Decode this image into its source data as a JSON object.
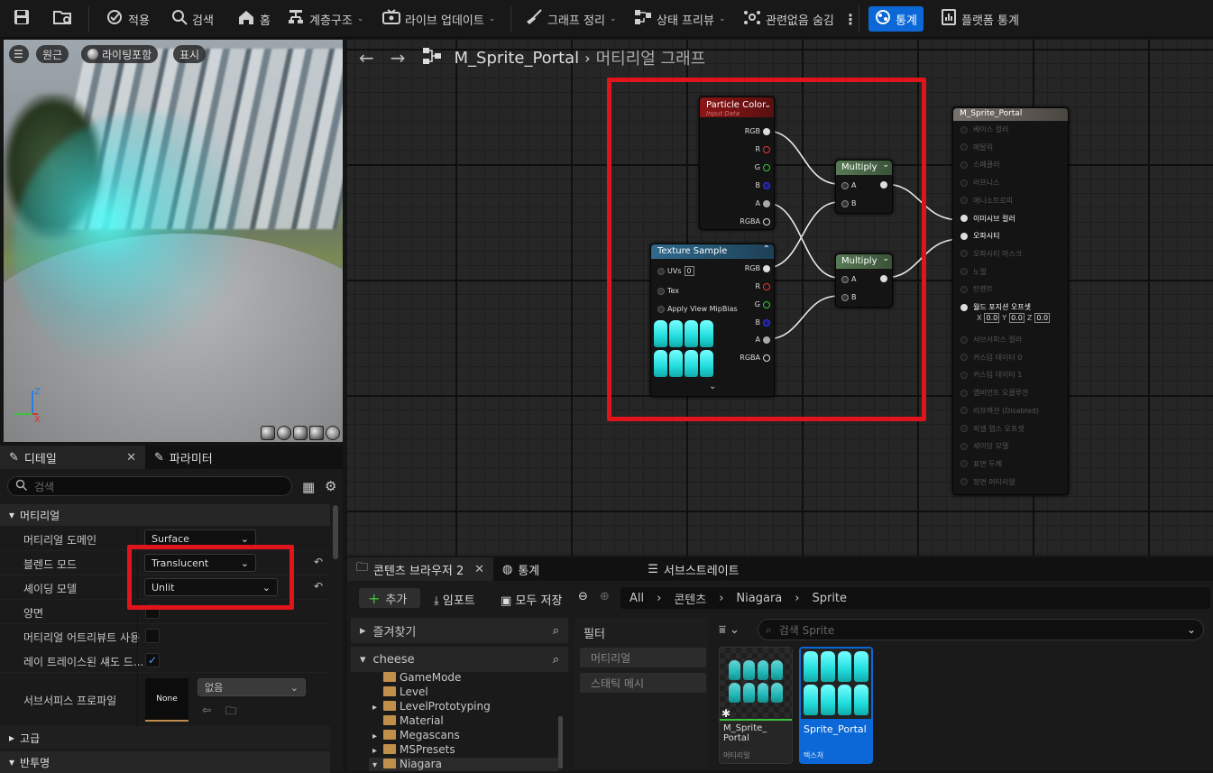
{
  "toolbar": {
    "apply": "적용",
    "search": "검색",
    "home": "홈",
    "hierarchy": "계층구조",
    "live_update": "라이브 업데이트",
    "clean_graph": "그래프 정리",
    "state_preview": "상태 프리뷰",
    "hide_unrelated": "관련없음 숨김",
    "stats": "통계",
    "platform_stats": "플랫폼 통계"
  },
  "viewport": {
    "btn_perspective": "원근",
    "btn_lit": "라이팅포함",
    "btn_show": "표시"
  },
  "details": {
    "tab_details": "디테일",
    "tab_params": "파라미터",
    "search_placeholder": "검색",
    "section_material": "머티리얼",
    "props": {
      "domain_label": "머티리얼 도메인",
      "domain_value": "Surface",
      "blend_label": "블렌드 모드",
      "blend_value": "Translucent",
      "shading_label": "셰이딩 모델",
      "shading_value": "Unlit",
      "twosided_label": "양면",
      "use_attr_label": "머티리얼 어트리뷰트 사용",
      "rt_shadow_label": "레이 트레이스된 섀도 드...",
      "subsurface_label": "서브서피스 프로파일",
      "subsurface_none": "None",
      "subsurface_value": "없음"
    },
    "rt_shadow_checked": true,
    "section_advanced": "고급",
    "section_translucency": "반투명"
  },
  "graph": {
    "asset_name": "M_Sprite_Portal",
    "graph_title": "머티리얼 그래프",
    "particle_color": {
      "title": "Particle Color",
      "subtitle": "Input Data",
      "pins": [
        "RGB",
        "R",
        "G",
        "B",
        "A",
        "RGBA"
      ]
    },
    "texture_sample": {
      "title": "Texture Sample",
      "inputs": [
        "UVs",
        "Tex",
        "Apply View MipBias"
      ],
      "uv_value": "0",
      "pins": [
        "RGB",
        "R",
        "G",
        "B",
        "A",
        "RGBA"
      ]
    },
    "multiply1": {
      "title": "Multiply",
      "a": "A",
      "b": "B"
    },
    "multiply2": {
      "title": "Multiply",
      "a": "A",
      "b": "B"
    },
    "result": {
      "title": "M_Sprite_Portal",
      "inputs": [
        "베이스 컬러",
        "메탈릭",
        "스페큘러",
        "러프니스",
        "애니소트로피",
        "이미시브 컬러",
        "오파시티",
        "오파시티 마스크",
        "노멀",
        "탄젠트",
        "월드 포지션 오프셋",
        "서브서피스 컬러",
        "커스텀 데이터 0",
        "커스텀 데이터 1",
        "앰비언트 오클루전",
        "리프랙션 (Disabled)",
        "픽셀 뎁스 오프셋",
        "셰이딩 모델",
        "표면 두께",
        "정면 머티리얼"
      ],
      "wpo": {
        "x": "0.0",
        "y": "0.0",
        "z": "0.0"
      }
    }
  },
  "content_browser": {
    "tab1": "콘텐츠 브라우저 2",
    "tab2": "통계",
    "tab3": "서브스트레이트",
    "add": "추가",
    "import": "임포트",
    "save_all": "모두 저장",
    "path": [
      "All",
      "콘텐츠",
      "Niagara",
      "Sprite"
    ],
    "favorites": "즐겨찾기",
    "project": "cheese",
    "folders": [
      "GameMode",
      "Level",
      "LevelPrototyping",
      "Material",
      "Megascans",
      "MSPresets",
      "Niagara"
    ],
    "filter_title": "필터",
    "filters": [
      "머티리얼",
      "스태틱 메시"
    ],
    "search_placeholder": "검색 Sprite",
    "assets": [
      {
        "name": "M_Sprite_\nPortal",
        "type": "머티리얼"
      },
      {
        "name": "Sprite_Portal",
        "type": "텍스처"
      }
    ]
  },
  "colors": {
    "accent": "#0b68d6",
    "highlight": "#e1141c",
    "particle_head": "#8c1616",
    "texture_head": "#2a5a7a",
    "multiply_head": "#4a6a48",
    "result_head": "#6d6762"
  }
}
